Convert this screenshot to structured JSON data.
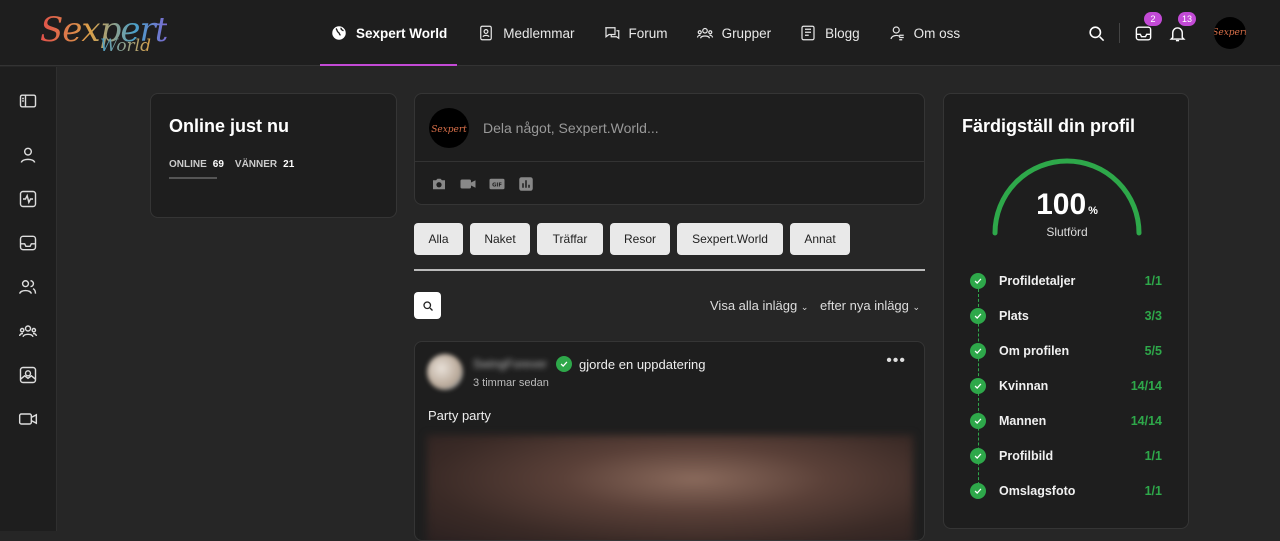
{
  "brand": {
    "name": "Sexpert",
    "sub": "World",
    "avatar_text": "Sexpert"
  },
  "nav": [
    {
      "label": "Sexpert World",
      "icon": "globe-icon",
      "active": true
    },
    {
      "label": "Medlemmar",
      "icon": "members-icon"
    },
    {
      "label": "Forum",
      "icon": "forum-icon"
    },
    {
      "label": "Grupper",
      "icon": "groups-icon"
    },
    {
      "label": "Blogg",
      "icon": "blog-icon"
    },
    {
      "label": "Om oss",
      "icon": "about-icon"
    }
  ],
  "header": {
    "messages_count": "2",
    "notifications_count": "13"
  },
  "online": {
    "title": "Online just nu",
    "online_label": "ONLINE",
    "online_count": "69",
    "friends_label": "VÄNNER",
    "friends_count": "21"
  },
  "composer": {
    "placeholder": "Dela något, Sexpert.World..."
  },
  "filters": [
    "Alla",
    "Naket",
    "Träffar",
    "Resor",
    "Sexpert.World",
    "Annat"
  ],
  "sort": {
    "show": "Visa alla inlägg",
    "order": "efter nya inlägg"
  },
  "post": {
    "author": "SwingForever",
    "action": "gjorde en uppdatering",
    "time": "3 timmar sedan",
    "text": "Party party",
    "menu": "•••"
  },
  "profile": {
    "title": "Färdigställ din profil",
    "percent": "100",
    "percent_sign": "%",
    "percent_value": 1.0,
    "status": "Slutförd",
    "accent": "#2ea84a",
    "steps": [
      {
        "label": "Profildetaljer",
        "value": "1/1"
      },
      {
        "label": "Plats",
        "value": "3/3"
      },
      {
        "label": "Om profilen",
        "value": "5/5"
      },
      {
        "label": "Kvinnan",
        "value": "14/14"
      },
      {
        "label": "Mannen",
        "value": "14/14"
      },
      {
        "label": "Profilbild",
        "value": "1/1"
      },
      {
        "label": "Omslagsfoto",
        "value": "1/1"
      }
    ]
  }
}
